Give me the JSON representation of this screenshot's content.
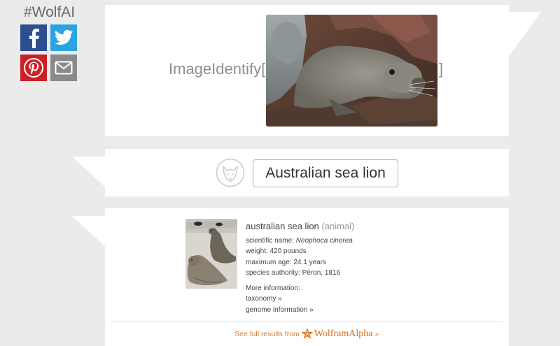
{
  "sidebar": {
    "hashtag": "#WolfAI",
    "share_buttons": [
      {
        "name": "facebook",
        "color": "#2d4f8d"
      },
      {
        "name": "twitter",
        "color": "#2aa3e2"
      },
      {
        "name": "pinterest",
        "color": "#cb2027"
      },
      {
        "name": "email",
        "color": "#8a8a8a"
      }
    ]
  },
  "input_card": {
    "function_name": "ImageIdentify",
    "open_bracket": "[",
    "close_bracket": "]",
    "image_subject": "fur seal resting on kelp"
  },
  "output_card": {
    "result": "Australian sea lion",
    "icon": "wolf-icon"
  },
  "details": {
    "title": "australian sea lion",
    "category": "(animal)",
    "scientific_name_label": "scientific name:",
    "scientific_name": "Neophoca cinerea",
    "weight": "weight: 420 pounds",
    "max_age": "maximum age: 24.1 years",
    "authority": "species authority: Péron, 1816",
    "more_info": "More information:",
    "taxonomy_link": "taxonomy »",
    "genome_link": "genome information »",
    "full_results_prefix": "See full results from",
    "brand": "WolframAlpha",
    "brand_suffix": "»"
  },
  "colors": {
    "accent": "#dd6b16",
    "background": "#ebebeb"
  }
}
